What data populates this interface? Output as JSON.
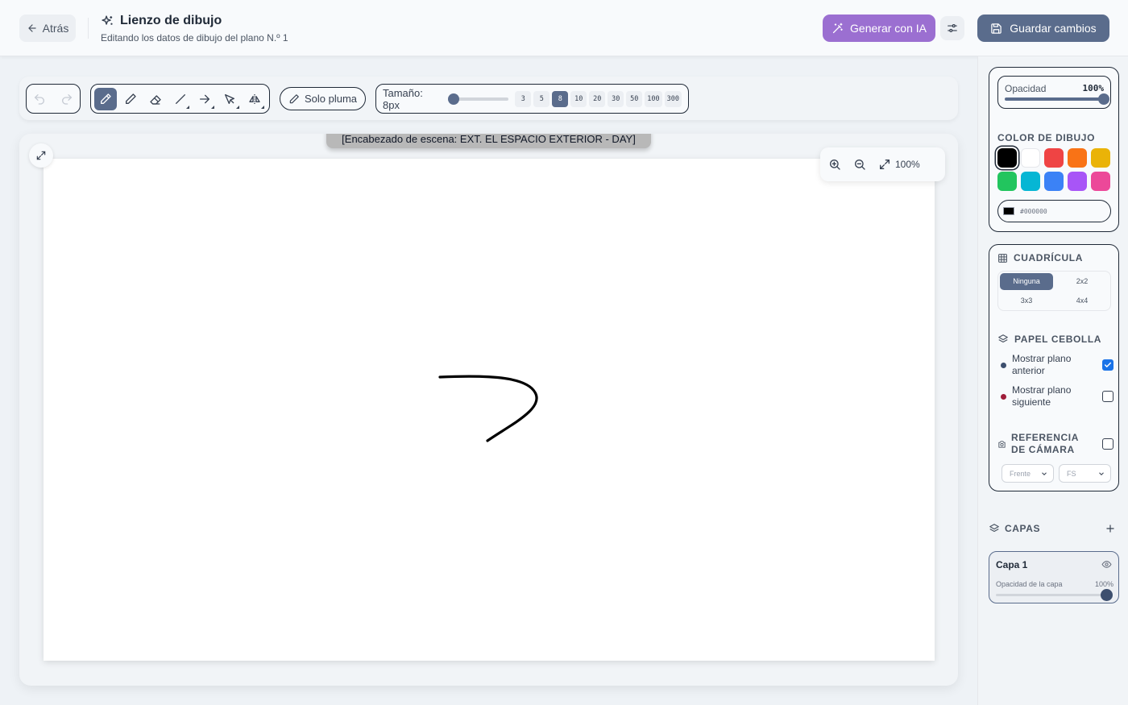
{
  "header": {
    "back_label": "Atrás",
    "title": "Lienzo de dibujo",
    "subtitle": "Editando los datos de dibujo del plano N.º 1",
    "generate_label": "Generar con IA",
    "save_label": "Guardar cambios"
  },
  "toolbar": {
    "tools": [
      {
        "name": "pen",
        "icon": "pen-icon",
        "active": true
      },
      {
        "name": "pencil",
        "icon": "pencil-icon",
        "active": false
      },
      {
        "name": "eraser",
        "icon": "eraser-icon",
        "active": false
      },
      {
        "name": "line",
        "icon": "line-icon",
        "active": false
      },
      {
        "name": "arrow",
        "icon": "arrow-icon",
        "active": false
      },
      {
        "name": "select",
        "icon": "select-icon",
        "active": false
      },
      {
        "name": "mirror",
        "icon": "mirror-icon",
        "active": false
      }
    ],
    "pen_only_label": "Solo pluma",
    "size_label": "Tamaño: 8px",
    "size_value_fraction": 0.02,
    "size_presets": [
      "3",
      "5",
      "8",
      "10",
      "20",
      "30",
      "50",
      "100",
      "300"
    ],
    "size_active": "8"
  },
  "canvas": {
    "scene_heading": "[Encabezado de escena: EXT. EL ESPACIO EXTERIOR - DAY]",
    "zoom_label": "100%",
    "stroke_color": "#000000"
  },
  "sidebar": {
    "opacity_label": "Opacidad",
    "opacity_value": "100%",
    "opacity_fraction": 1.0,
    "color_section": "COLOR DE DIBUJO",
    "colors": [
      "#000000",
      "#ffffff",
      "#ef4444",
      "#f97316",
      "#eab308",
      "#22c55e",
      "#06b6d4",
      "#3b82f6",
      "#a855f7",
      "#ec4899"
    ],
    "selected_color": "#000000",
    "hex_value": "#000000",
    "grid_section": "CUADRÍCULA",
    "grid_options": [
      "Ninguna",
      "2x2",
      "3x3",
      "4x4"
    ],
    "grid_active": "Ninguna",
    "onion_section": "PAPEL CEBOLLA",
    "onion_prev_label": "Mostrar plano anterior",
    "onion_prev_checked": true,
    "onion_prev_color": "#3d4f6e",
    "onion_next_label": "Mostrar plano siguiente",
    "onion_next_checked": false,
    "onion_next_color": "#9f1d3a",
    "camera_section": "REFERENCIA DE CÁMARA",
    "camera_checked": false,
    "camera_angle": "Frente",
    "camera_shot": "FS",
    "layers_section": "CAPAS",
    "layers": [
      {
        "name": "Capa 1",
        "opacity_label": "Opacidad de la capa",
        "opacity_value": "100%",
        "opacity_fraction": 1.0
      }
    ]
  },
  "colors": {
    "accent": "#5a6c8c",
    "generate": "#9b6fd1"
  }
}
